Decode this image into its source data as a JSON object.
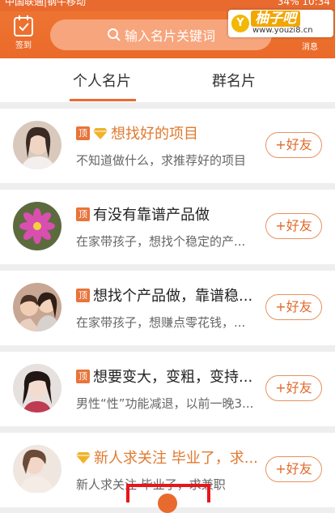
{
  "status_bar": {
    "carrier": "中国联通|钢牛移动",
    "right": "34% 10:34"
  },
  "header": {
    "signin_label": "签到",
    "search_placeholder": "输入名片关键词",
    "message_label": "消息"
  },
  "watermark": {
    "badge": "Y",
    "brand": "柚子吧",
    "url": "www.youzi8.cn"
  },
  "tabs": {
    "personal": "个人名片",
    "group": "群名片",
    "active": "personal"
  },
  "cards": [
    {
      "ding": "顶",
      "has_diamond": true,
      "title": "想找好的项目",
      "title_color": "orange",
      "desc": "不知道做什么，求推荐好的项目",
      "button": "+好友"
    },
    {
      "ding": "顶",
      "has_diamond": false,
      "title": "有没有靠谱产品做",
      "title_color": "dark",
      "desc": "在家带孩子，想找个稳定的产...",
      "button": "+好友"
    },
    {
      "ding": "顶",
      "has_diamond": false,
      "title": "想找个产品做，靠谱稳...",
      "title_color": "dark",
      "desc": "在家带孩子，想赚点零花钱，...",
      "button": "+好友"
    },
    {
      "ding": "顶",
      "has_diamond": false,
      "title": "想要变大，变粗，变持...",
      "title_color": "dark",
      "desc": "男性“性”功能减退，以前一晚3...",
      "button": "+好友"
    },
    {
      "ding": "",
      "has_diamond": true,
      "title": "新人求关注 毕业了，求...",
      "title_color": "orange",
      "desc": "新人求关注 毕业了，求兼职",
      "button": "+好友"
    }
  ],
  "colors": {
    "accent": "#e96a2f",
    "highlight_box": "#e8151b"
  }
}
